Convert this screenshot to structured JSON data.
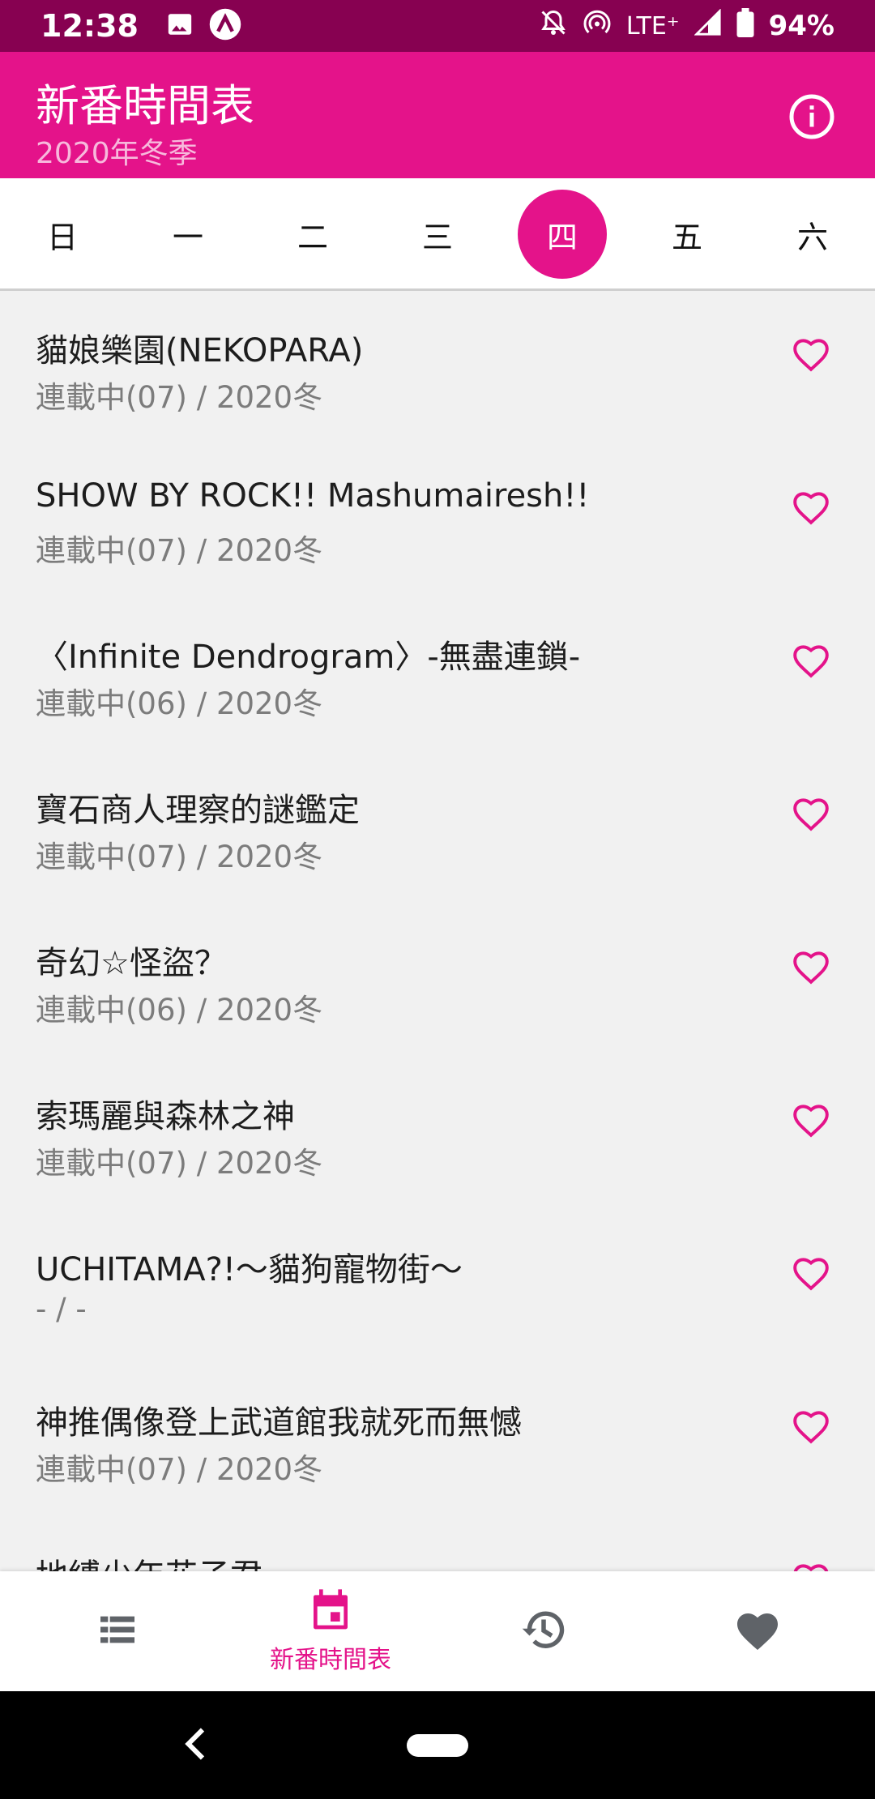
{
  "status_bar": {
    "time": "12:38",
    "network": "LTE⁺",
    "battery": "94%",
    "icons": [
      "image-icon",
      "app-a-icon",
      "notifications-off-icon",
      "hotspot-icon",
      "signal-icon",
      "battery-icon"
    ]
  },
  "app_bar": {
    "title": "新番時間表",
    "subtitle": "2020年冬季",
    "info_icon": "info-icon"
  },
  "days": [
    {
      "label": "日",
      "selected": false
    },
    {
      "label": "一",
      "selected": false
    },
    {
      "label": "二",
      "selected": false
    },
    {
      "label": "三",
      "selected": false
    },
    {
      "label": "四",
      "selected": true
    },
    {
      "label": "五",
      "selected": false
    },
    {
      "label": "六",
      "selected": false
    }
  ],
  "anime_list": [
    {
      "title": "貓娘樂園(NEKOPARA)",
      "status": "連載中(07) / 2020冬"
    },
    {
      "title": "SHOW BY ROCK!! Mashumairesh!!",
      "status": "連載中(07) / 2020冬"
    },
    {
      "title": "〈Infinite Dendrogram〉-無盡連鎖-",
      "status": "連載中(06) / 2020冬"
    },
    {
      "title": "寶石商人理察的謎鑑定",
      "status": "連載中(07) / 2020冬"
    },
    {
      "title": "奇幻☆怪盜？",
      "status": "連載中(06) / 2020冬"
    },
    {
      "title": "索瑪麗與森林之神",
      "status": "連載中(07) / 2020冬"
    },
    {
      "title": "UCHITAMA?!〜貓狗寵物街〜",
      "status": "- / -"
    },
    {
      "title": "神推偶像登上武道館我就死而無憾",
      "status": "連載中(07) / 2020冬"
    },
    {
      "title": "地縛少年花子君",
      "status": ""
    }
  ],
  "bottom_nav": {
    "items": [
      {
        "icon": "list-icon",
        "label": "",
        "active": false
      },
      {
        "icon": "calendar-icon",
        "label": "新番時間表",
        "active": true
      },
      {
        "icon": "history-icon",
        "label": "",
        "active": false
      },
      {
        "icon": "favorite-icon",
        "label": "",
        "active": false
      }
    ]
  },
  "colors": {
    "accent": "#e4138a",
    "status_bar": "#870151",
    "list_background": "#f1f1f1"
  }
}
